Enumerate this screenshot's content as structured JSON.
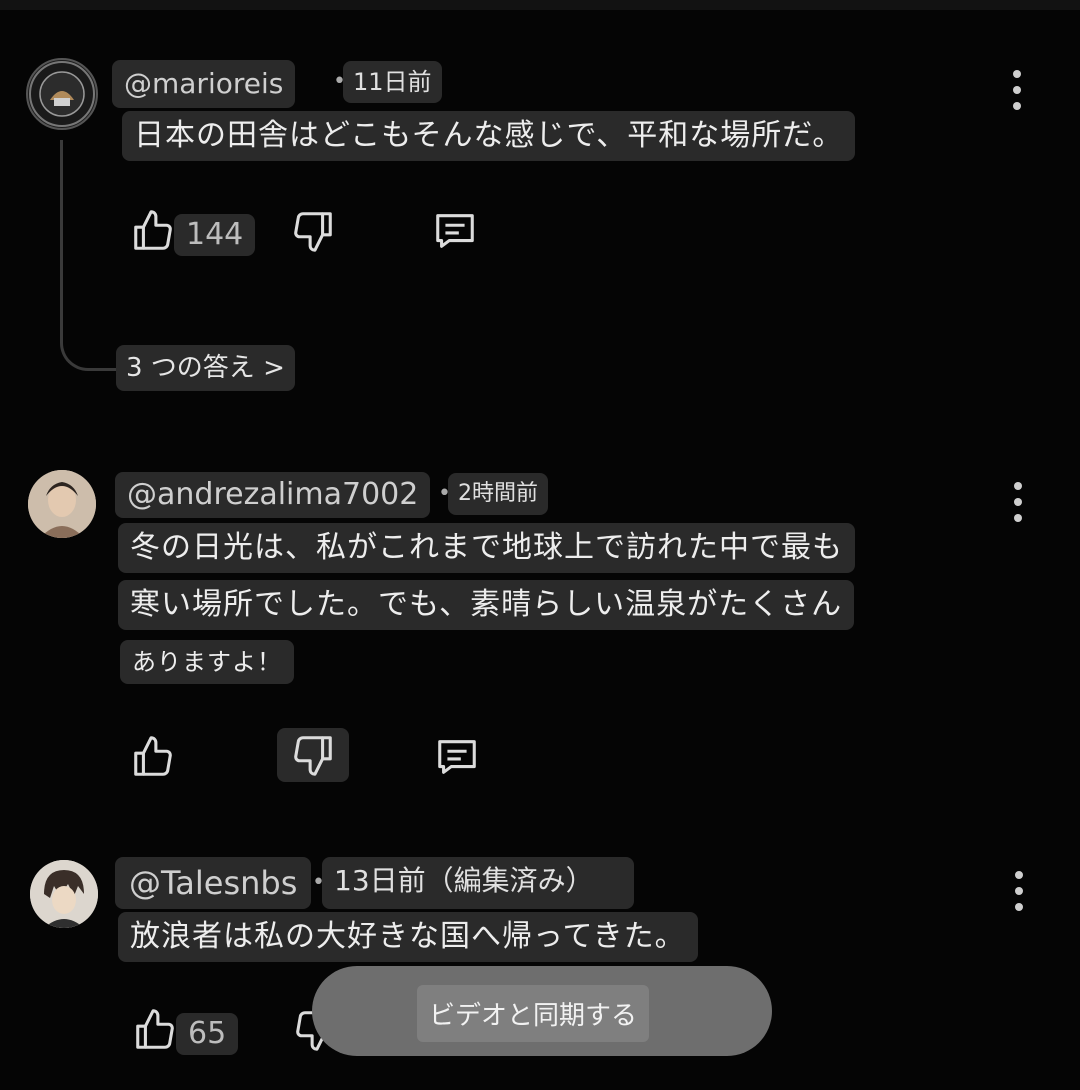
{
  "comments": [
    {
      "author": "@marioreis",
      "separator": "•",
      "time": "11日前",
      "lines": [
        "日本の田舎はどこもそんな感じで、平和な場所だ。"
      ],
      "like_count": "144",
      "replies_label": "3 つの答え >"
    },
    {
      "author": "@andrezalima7002",
      "separator": "•",
      "time": "2時間前",
      "lines": [
        "冬の日光は、私がこれまで地球上で訪れた中で最も",
        "寒い場所でした。でも、素晴らしい温泉がたくさん",
        "ありますよ！"
      ],
      "like_count": ""
    },
    {
      "author": "@Talesnbs",
      "separator": "•",
      "time": "13日前（編集済み）",
      "lines": [
        "放浪者は私の大好きな国へ帰ってきた。"
      ],
      "like_count": "65"
    }
  ],
  "toast": {
    "label": "ビデオと同期する"
  },
  "icons": {
    "like": "thumbs-up-icon",
    "dislike": "thumbs-down-icon",
    "reply": "comment-icon",
    "more": "more-vertical-icon"
  },
  "colors": {
    "background": "#050505",
    "chip": "#2a2a2a",
    "toast": "#6e6e6e"
  }
}
